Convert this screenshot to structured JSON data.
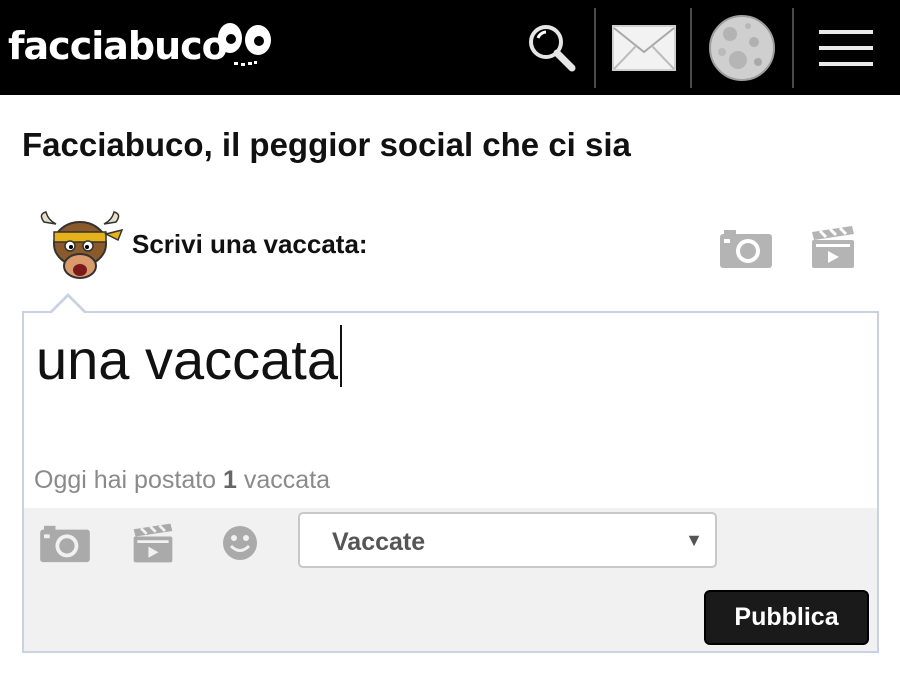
{
  "header": {
    "logo_text": "facciabuco",
    "nav": [
      "search-icon",
      "mail-icon",
      "moon-avatar-icon",
      "menu-icon"
    ]
  },
  "page": {
    "title": "Facciabuco, il peggior social che ci sia"
  },
  "composer": {
    "label": "Scrivi una vaccata:",
    "text_value": "una vaccata",
    "counter_prefix": "Oggi hai postato",
    "counter_count": "1",
    "counter_suffix": "vaccata",
    "category_selected": "Vaccate",
    "publish_label": "Pubblica"
  },
  "colors": {
    "topbar": "#000000",
    "composer_border": "#c9d2e3",
    "footer_bg": "#f1f1f1",
    "publish_bg": "#1a1a1a",
    "icon_gray": "#9a9a9a"
  }
}
